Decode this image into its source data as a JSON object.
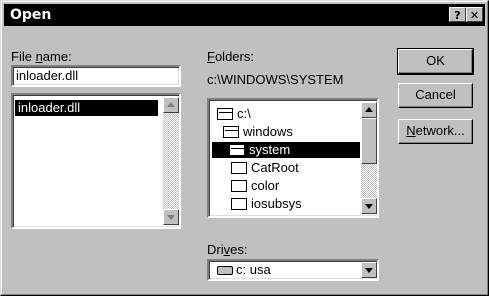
{
  "window": {
    "title": "Open",
    "help_button": "?",
    "close_button": "✕"
  },
  "file_name": {
    "label_pre": "File ",
    "label_u": "n",
    "label_post": "ame:",
    "value": "inloader.dll",
    "list_items": [
      "inloader.dll"
    ]
  },
  "folders": {
    "label_u": "F",
    "label_post": "olders:",
    "current_path": "c:\\WINDOWS\\SYSTEM",
    "tree": [
      "c:\\",
      "windows",
      "system",
      "CatRoot",
      "color",
      "iosubsys"
    ],
    "selected_index": 2
  },
  "drives": {
    "label_pre": "Dri",
    "label_u": "v",
    "label_post": "es:",
    "value": "c: usa"
  },
  "buttons": {
    "ok": "OK",
    "cancel": "Cancel",
    "network_pre": "N",
    "network_post": "etwork..."
  },
  "icons": [
    "help-icon",
    "close-icon",
    "scroll-up-arrow-icon",
    "scroll-down-arrow-icon",
    "folder-icon",
    "open-folder-icon",
    "drive-icon",
    "dropdown-arrow-icon"
  ]
}
